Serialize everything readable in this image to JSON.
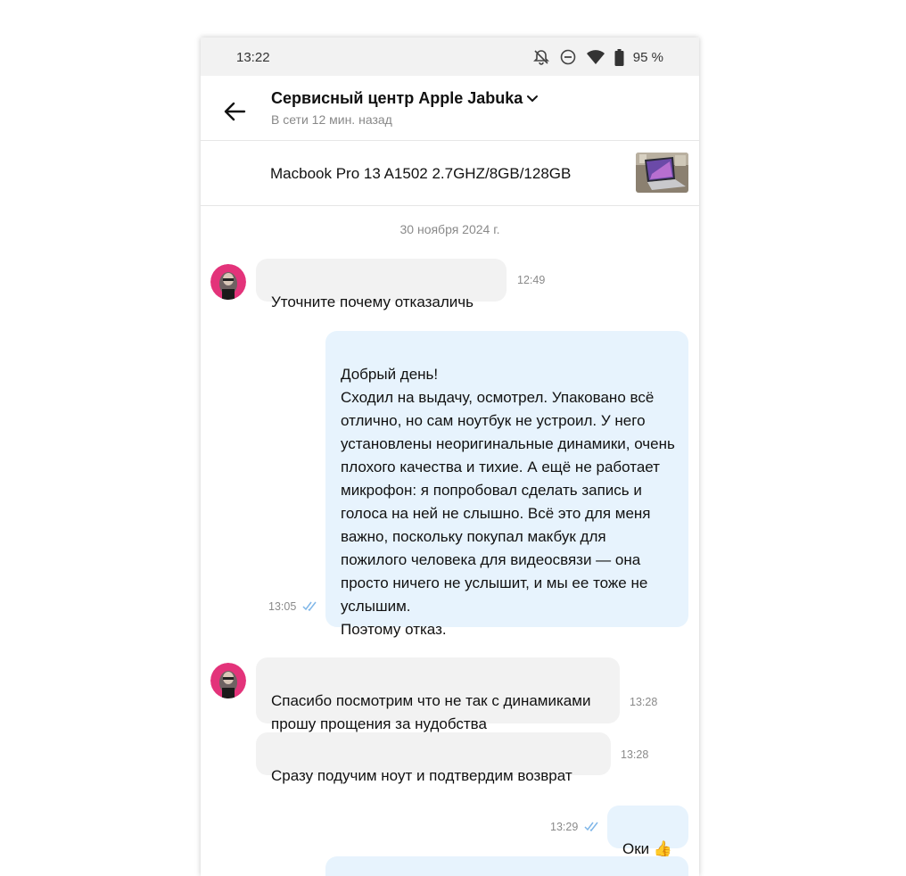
{
  "status_bar": {
    "time": "13:22",
    "battery": "95 %",
    "icons": [
      "bell-off-icon",
      "do-not-disturb-icon",
      "wifi-icon",
      "battery-icon"
    ]
  },
  "header": {
    "title": "Сервисный центр Apple Jabuka",
    "subtitle": "В сети 12 мин. назад"
  },
  "product": {
    "name": "Macbook Pro 13 A1502 2.7GHZ/8GB/128GB"
  },
  "chat": {
    "date_separator": "30 ноября 2024 г.",
    "messages": [
      {
        "side": "in",
        "text": "Уточните почему отказаличь",
        "time": "12:49"
      },
      {
        "side": "out",
        "text": "Добрый день!\nСходил на выдачу, осмотрел. Упаковано всё отлично, но сам ноутбук не устроил. У него установлены неоригинальные динамики, очень плохого качества и тихие. А ещё не работает микрофон: я попробовал сделать запись и голоса на ней не слышно. Всё это для меня важно, поскольку покупал макбук для пожилого человека для видеосвязи — она просто ничего не услышит, и мы ее тоже не услышим.\nПоэтому отказ.",
        "time": "13:05"
      },
      {
        "side": "in",
        "text": "Спасибо посмотрим что не так с динамиками прошу прощения за нудобства",
        "time": "13:28"
      },
      {
        "side": "in",
        "text": "Сразу подучим ноут и подтвердим возврат",
        "time": "13:28"
      },
      {
        "side": "out",
        "text": "Оки 👍",
        "time": "13:29"
      }
    ]
  },
  "colors": {
    "incoming_bubble": "#f2f2f2",
    "outgoing_bubble": "#e7f3fd",
    "read_ticks": "#7fb6e8"
  }
}
